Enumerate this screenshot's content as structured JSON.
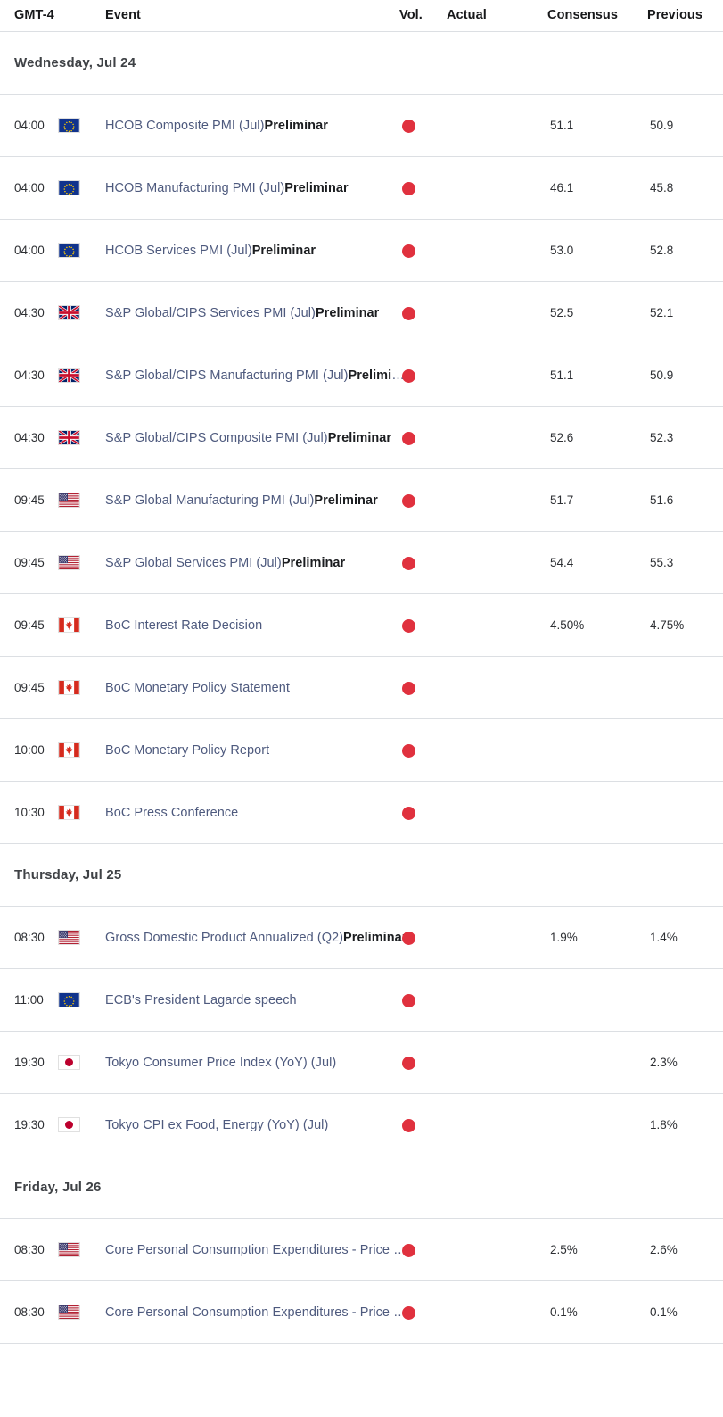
{
  "columns": {
    "time": "GMT-4",
    "event": "Event",
    "vol": "Vol.",
    "actual": "Actual",
    "consensus": "Consensus",
    "previous": "Previous"
  },
  "volatility_color": "#e0313e",
  "link_color": "#4e5a7e",
  "sections": [
    {
      "date_label": "Wednesday, Jul 24",
      "rows": [
        {
          "time": "04:00",
          "flag": "eu-flag-icon",
          "event": "HCOB Composite PMI (Jul)",
          "event_suffix": "Preliminar",
          "vol": "high-volatility-dot",
          "actual": "",
          "consensus": "51.1",
          "previous": "50.9"
        },
        {
          "time": "04:00",
          "flag": "eu-flag-icon",
          "event": "HCOB Manufacturing PMI (Jul)",
          "event_suffix": "Preliminar",
          "vol": "high-volatility-dot",
          "actual": "",
          "consensus": "46.1",
          "previous": "45.8"
        },
        {
          "time": "04:00",
          "flag": "eu-flag-icon",
          "event": "HCOB Services PMI (Jul)",
          "event_suffix": "Preliminar",
          "vol": "high-volatility-dot",
          "actual": "",
          "consensus": "53.0",
          "previous": "52.8"
        },
        {
          "time": "04:30",
          "flag": "uk-flag-icon",
          "event": "S&P Global/CIPS Services PMI (Jul)",
          "event_suffix": "Preliminar",
          "vol": "high-volatility-dot",
          "actual": "",
          "consensus": "52.5",
          "previous": "52.1"
        },
        {
          "time": "04:30",
          "flag": "uk-flag-icon",
          "event": "S&P Global/CIPS Manufacturing PMI (Jul)",
          "event_suffix": "Preliminar",
          "vol": "high-volatility-dot",
          "actual": "",
          "consensus": "51.1",
          "previous": "50.9"
        },
        {
          "time": "04:30",
          "flag": "uk-flag-icon",
          "event": "S&P Global/CIPS Composite PMI (Jul)",
          "event_suffix": "Preliminar",
          "vol": "high-volatility-dot",
          "actual": "",
          "consensus": "52.6",
          "previous": "52.3"
        },
        {
          "time": "09:45",
          "flag": "us-flag-icon",
          "event": "S&P Global Manufacturing PMI (Jul)",
          "event_suffix": "Preliminar",
          "vol": "high-volatility-dot",
          "actual": "",
          "consensus": "51.7",
          "previous": "51.6"
        },
        {
          "time": "09:45",
          "flag": "us-flag-icon",
          "event": "S&P Global Services PMI (Jul)",
          "event_suffix": "Preliminar",
          "vol": "high-volatility-dot",
          "actual": "",
          "consensus": "54.4",
          "previous": "55.3"
        },
        {
          "time": "09:45",
          "flag": "ca-flag-icon",
          "event": "BoC Interest Rate Decision",
          "event_suffix": "",
          "vol": "high-volatility-dot",
          "actual": "",
          "consensus": "4.50%",
          "previous": "4.75%"
        },
        {
          "time": "09:45",
          "flag": "ca-flag-icon",
          "event": "BoC Monetary Policy Statement",
          "event_suffix": "",
          "vol": "high-volatility-dot",
          "actual": "",
          "consensus": "",
          "previous": ""
        },
        {
          "time": "10:00",
          "flag": "ca-flag-icon",
          "event": "BoC Monetary Policy Report",
          "event_suffix": "",
          "vol": "high-volatility-dot",
          "actual": "",
          "consensus": "",
          "previous": ""
        },
        {
          "time": "10:30",
          "flag": "ca-flag-icon",
          "event": "BoC Press Conference",
          "event_suffix": "",
          "vol": "high-volatility-dot",
          "actual": "",
          "consensus": "",
          "previous": ""
        }
      ]
    },
    {
      "date_label": "Thursday, Jul 25",
      "rows": [
        {
          "time": "08:30",
          "flag": "us-flag-icon",
          "event": "Gross Domestic Product Annualized (Q2)",
          "event_suffix": "Preliminar",
          "vol": "high-volatility-dot",
          "actual": "",
          "consensus": "1.9%",
          "previous": "1.4%"
        },
        {
          "time": "11:00",
          "flag": "eu-flag-icon",
          "event": "ECB's President Lagarde speech",
          "event_suffix": "",
          "vol": "high-volatility-dot",
          "actual": "",
          "consensus": "",
          "previous": ""
        },
        {
          "time": "19:30",
          "flag": "jp-flag-icon",
          "event": "Tokyo Consumer Price Index (YoY) (Jul)",
          "event_suffix": "",
          "vol": "high-volatility-dot",
          "actual": "",
          "consensus": "",
          "previous": "2.3%"
        },
        {
          "time": "19:30",
          "flag": "jp-flag-icon",
          "event": "Tokyo CPI ex Food, Energy (YoY) (Jul)",
          "event_suffix": "",
          "vol": "high-volatility-dot",
          "actual": "",
          "consensus": "",
          "previous": "1.8%"
        }
      ]
    },
    {
      "date_label": "Friday, Jul 26",
      "rows": [
        {
          "time": "08:30",
          "flag": "us-flag-icon",
          "event": "Core Personal Consumption Expenditures - Price Index (YoY) (Jun)",
          "event_suffix": "",
          "vol": "high-volatility-dot",
          "actual": "",
          "consensus": "2.5%",
          "previous": "2.6%"
        },
        {
          "time": "08:30",
          "flag": "us-flag-icon",
          "event": "Core Personal Consumption Expenditures - Price Index (MoM) (Jun)",
          "event_suffix": "",
          "vol": "high-volatility-dot",
          "actual": "",
          "consensus": "0.1%",
          "previous": "0.1%"
        }
      ]
    }
  ]
}
